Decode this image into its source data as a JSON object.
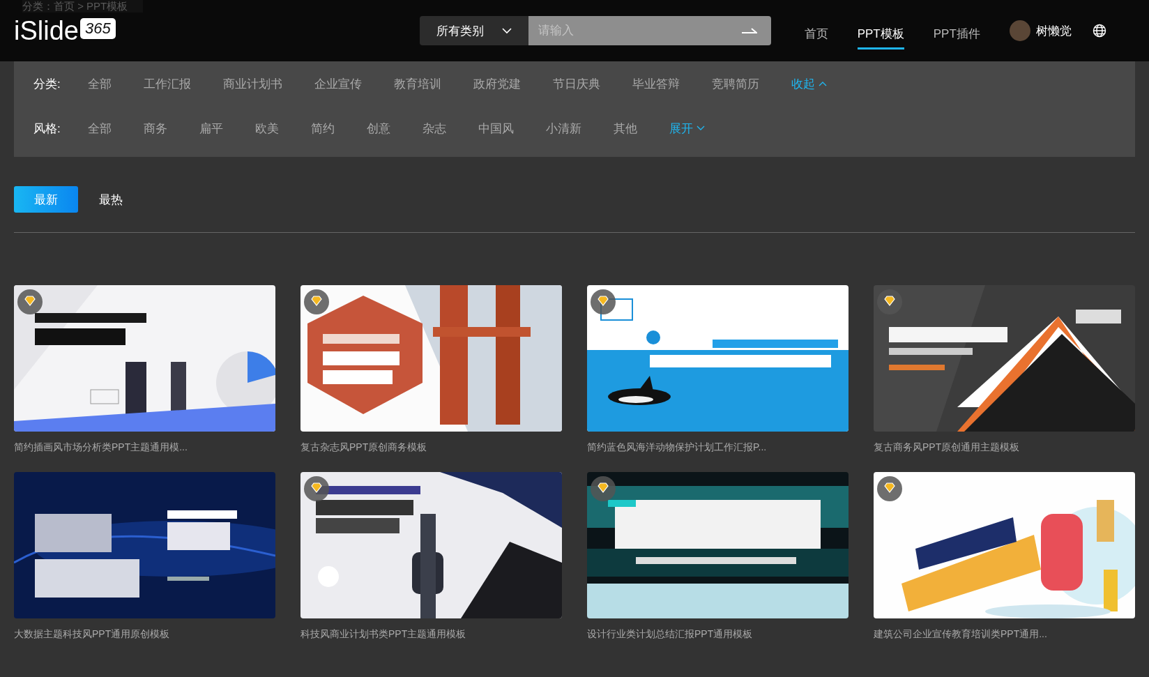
{
  "breadcrumb": "分类：首页 > PPT模板",
  "logo": {
    "name": "iSlide",
    "badge": "365"
  },
  "search": {
    "category": "所有类别",
    "placeholder": "请输入"
  },
  "nav": [
    {
      "label": "首页",
      "selected": false
    },
    {
      "label": "PPT模板",
      "selected": true
    },
    {
      "label": "PPT插件",
      "selected": false
    }
  ],
  "user": {
    "name": "树懒觉"
  },
  "filters": [
    {
      "label": "分类:",
      "options": [
        "全部",
        "工作汇报",
        "商业计划书",
        "企业宣传",
        "教育培训",
        "政府党建",
        "节日庆典",
        "毕业答辩",
        "竞聘简历"
      ],
      "toggle": "收起",
      "expanded": true
    },
    {
      "label": "风格:",
      "options": [
        "全部",
        "商务",
        "扁平",
        "欧美",
        "简约",
        "创意",
        "杂志",
        "中国风",
        "小清新",
        "其他"
      ],
      "toggle": "展开",
      "expanded": false
    }
  ],
  "sort_tabs": [
    {
      "label": "最新",
      "selected": true
    },
    {
      "label": "最热",
      "selected": false
    }
  ],
  "cards": [
    {
      "title": "简约插画风市场分析类PPT主题通用模...",
      "premium": true
    },
    {
      "title": "复古杂志风PPT原创商务模板",
      "premium": true
    },
    {
      "title": "简约蓝色风海洋动物保护计划工作汇报P...",
      "premium": true
    },
    {
      "title": "复古商务风PPT原创通用主题模板",
      "premium": true
    },
    {
      "title": "大数据主题科技风PPT通用原创模板",
      "premium": false
    },
    {
      "title": "科技风商业计划书类PPT主题通用模板",
      "premium": true
    },
    {
      "title": "设计行业类计划总结汇报PPT通用模板",
      "premium": true
    },
    {
      "title": "建筑公司企业宣传教育培训类PPT通用...",
      "premium": true
    }
  ]
}
